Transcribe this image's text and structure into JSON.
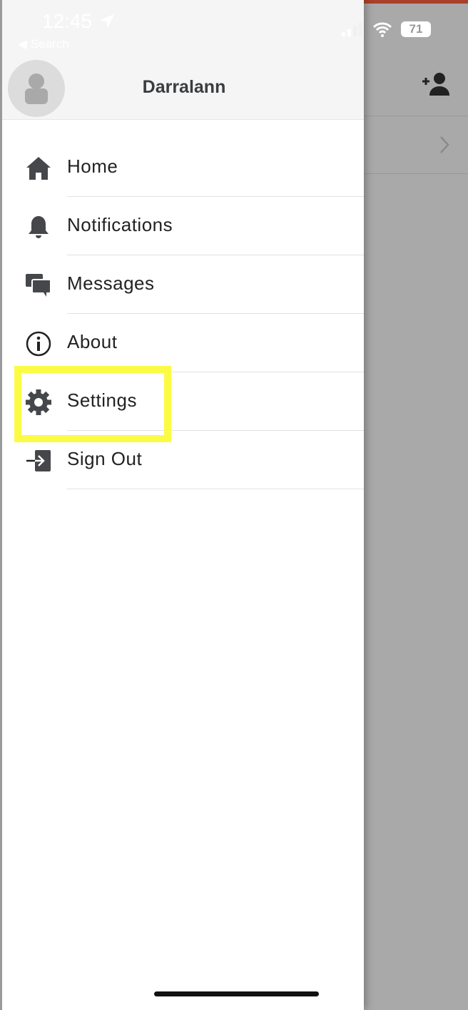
{
  "status_bar": {
    "time": "12:45",
    "back_label": "◀ Search",
    "battery": "71"
  },
  "header": {
    "username": "Darralann"
  },
  "menu": [
    {
      "label": "Home",
      "icon": "home-icon"
    },
    {
      "label": "Notifications",
      "icon": "bell-icon"
    },
    {
      "label": "Messages",
      "icon": "messages-icon"
    },
    {
      "label": "About",
      "icon": "info-icon"
    },
    {
      "label": "Settings",
      "icon": "gear-icon",
      "highlighted": true
    },
    {
      "label": "Sign Out",
      "icon": "sign-out-icon"
    }
  ],
  "colors": {
    "highlight": "#fbfb46",
    "icon": "#45474b",
    "overlay": "#a9a9a9"
  }
}
